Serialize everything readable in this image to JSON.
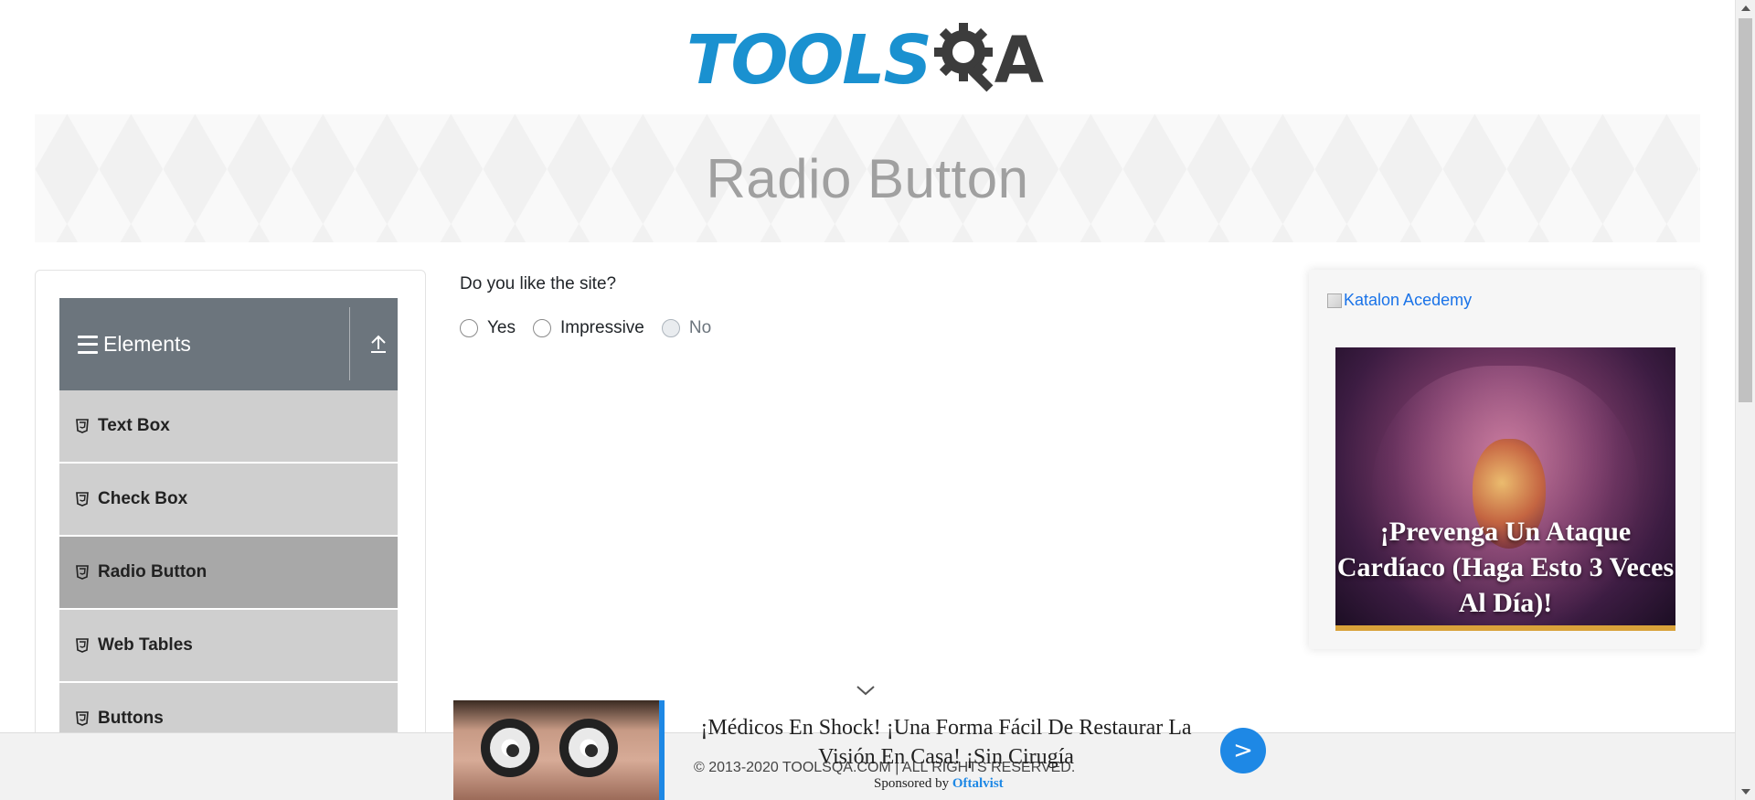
{
  "logo": {
    "text_left": "TOOLS",
    "text_right": "A",
    "alt": "TOOLSQA"
  },
  "banner": {
    "title": "Radio Button"
  },
  "sidebar": {
    "group_title": "Elements",
    "items": [
      {
        "label": "Text Box",
        "active": false
      },
      {
        "label": "Check Box",
        "active": false
      },
      {
        "label": "Radio Button",
        "active": true
      },
      {
        "label": "Web Tables",
        "active": false
      },
      {
        "label": "Buttons",
        "active": false
      }
    ]
  },
  "main": {
    "question": "Do you like the site?",
    "options": [
      {
        "label": "Yes",
        "disabled": false,
        "checked": false
      },
      {
        "label": "Impressive",
        "disabled": false,
        "checked": false
      },
      {
        "label": "No",
        "disabled": true,
        "checked": false
      }
    ]
  },
  "right_ad": {
    "link_text": "Katalon Acedemy",
    "headline": "¡Prevenga Un Ataque Cardíaco (Haga Esto 3 Veces Al Día)!"
  },
  "bottom_ad": {
    "headline": "¡Médicos En Shock! ¡Una Forma Fácil De Restaurar La Visión En Casa! ¡Sin Cirugía",
    "next_label": ">",
    "sponsored_prefix": "Sponsored by",
    "sponsor": "Oftalvist"
  },
  "footer": {
    "copyright": "© 2013-2020 TOOLSQA.COM | ALL RIGHTS RESERVED."
  },
  "colors": {
    "logo_blue": "#1a91d0",
    "logo_dark": "#3c3c3c",
    "sidebar_header": "#6c757d",
    "sidebar_item": "#cfcfcf",
    "sidebar_active": "#a8a8a8",
    "link": "#1a73e8",
    "ad_accent": "#1e88e5"
  },
  "icons": {
    "menu": "hamburger-icon",
    "collapse": "upload-arrow-icon",
    "item": "html5-icon",
    "scroll_down": "chevron-down-icon",
    "next": "arrow-right-icon"
  }
}
